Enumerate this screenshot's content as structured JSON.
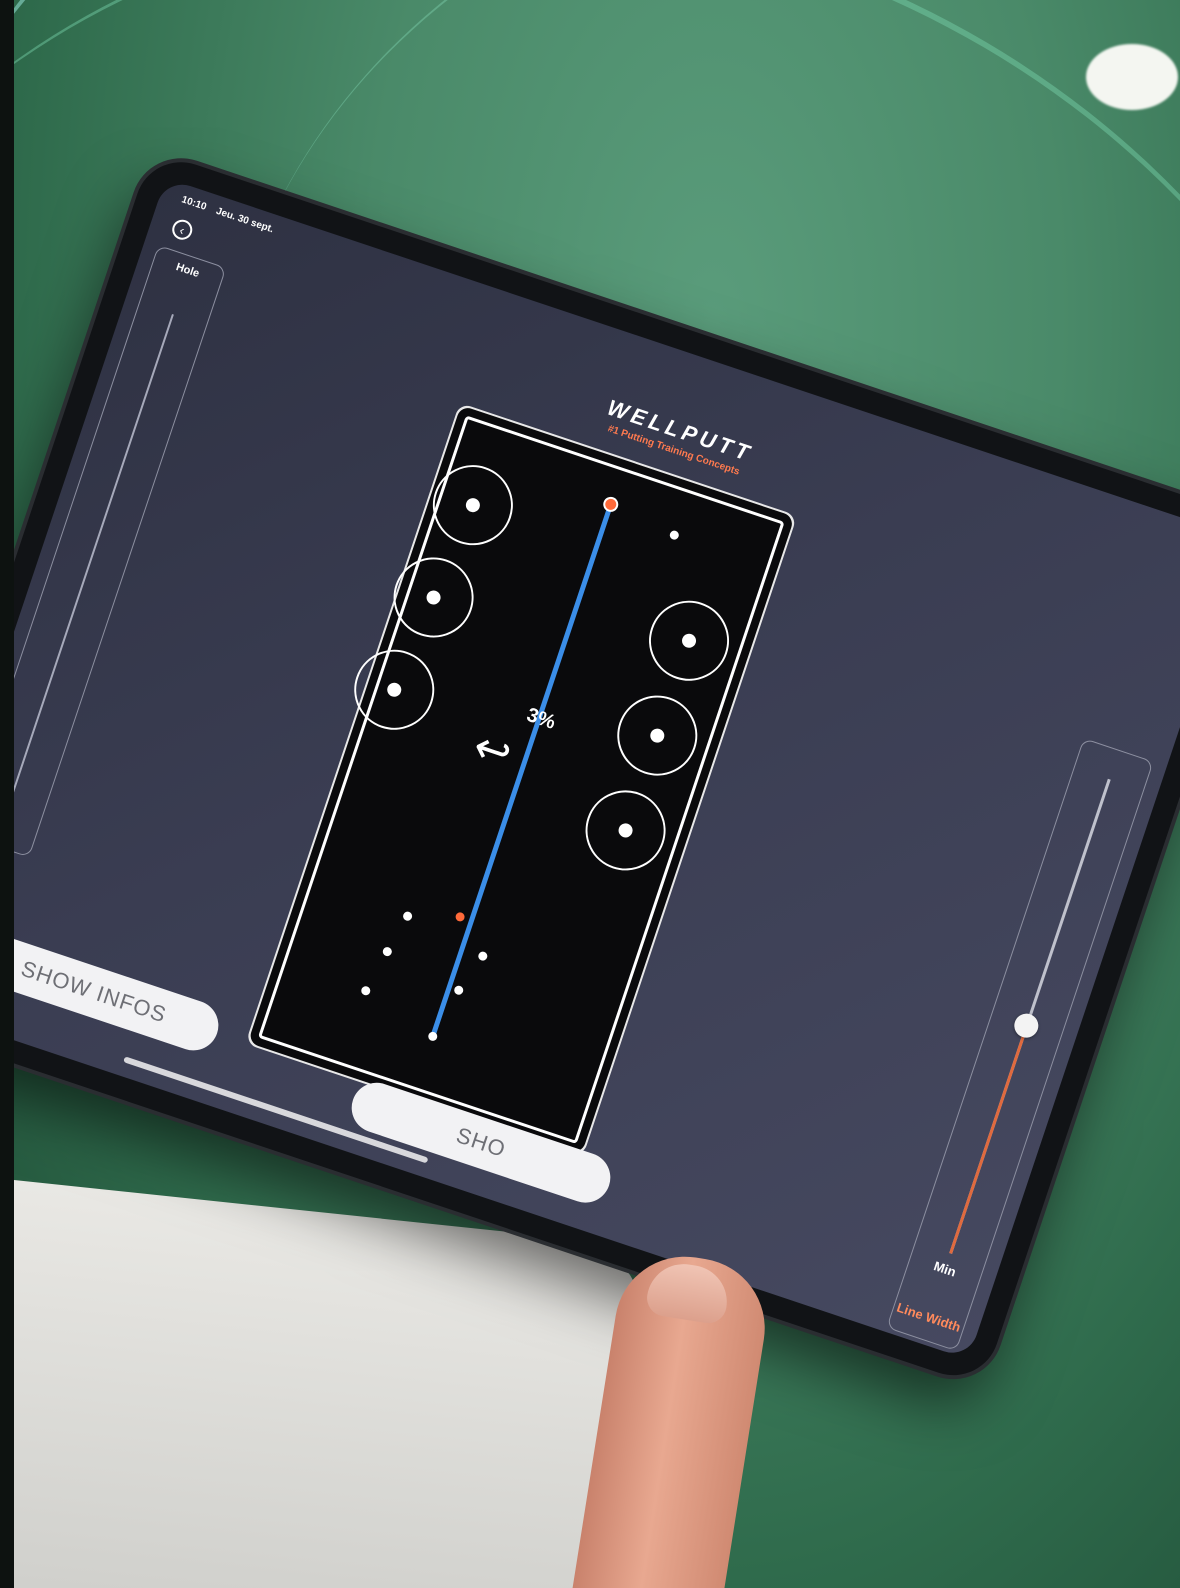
{
  "status_bar": {
    "time": "10:10",
    "date": "Jeu. 30 sept."
  },
  "left_panel": {
    "label": "Hole"
  },
  "header": {
    "brand": "WELLPUTT",
    "tagline": "#1 Putting Training Concepts"
  },
  "mat": {
    "slope_percent": "3%",
    "slope_arrow": "↩"
  },
  "right_panel": {
    "min_label": "Min",
    "title": "Line Width",
    "slider_level_fraction": 0.5
  },
  "buttons": {
    "show_infos": "SHOW INFOS",
    "second_button_visible_text": "SHO"
  },
  "colors": {
    "accent": "#ff7a4f",
    "aim_line": "#3b8ee8",
    "screen_bg": "#3a3d52",
    "green": "#4a8a69"
  }
}
